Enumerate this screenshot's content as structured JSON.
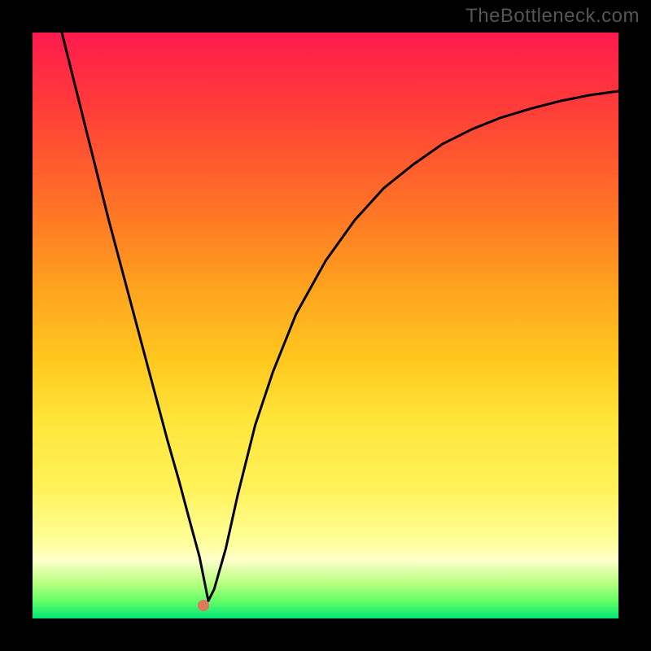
{
  "watermark": "TheBottleneck.com",
  "colors": {
    "background": "#000000",
    "gradient_top": "#ff1a4d",
    "gradient_bottom": "#00e676",
    "curve": "#000000",
    "dot": "#e07a5f"
  },
  "chart_data": {
    "type": "line",
    "title": "",
    "xlabel": "",
    "ylabel": "",
    "xlim": [
      0,
      100
    ],
    "ylim": [
      0,
      100
    ],
    "grid": false,
    "legend": false,
    "annotations": [],
    "series": [
      {
        "name": "bottleneck-curve",
        "x": [
          5,
          7,
          9,
          11,
          13,
          15,
          17,
          19,
          21,
          23,
          25,
          27,
          28.5,
          30,
          31,
          33,
          35,
          38,
          41,
          45,
          50,
          55,
          60,
          65,
          70,
          75,
          80,
          85,
          90,
          95,
          100
        ],
        "values": [
          100,
          92,
          84,
          76,
          68,
          60.5,
          53,
          45.5,
          38,
          30.5,
          23.5,
          16,
          10.5,
          3,
          5,
          12,
          21,
          33,
          42,
          52,
          61,
          68,
          73.5,
          77.5,
          81,
          83.5,
          85.5,
          87,
          88.3,
          89.3,
          90
        ]
      }
    ],
    "marker": {
      "x": 29.2,
      "y": 2.2,
      "label": ""
    }
  }
}
